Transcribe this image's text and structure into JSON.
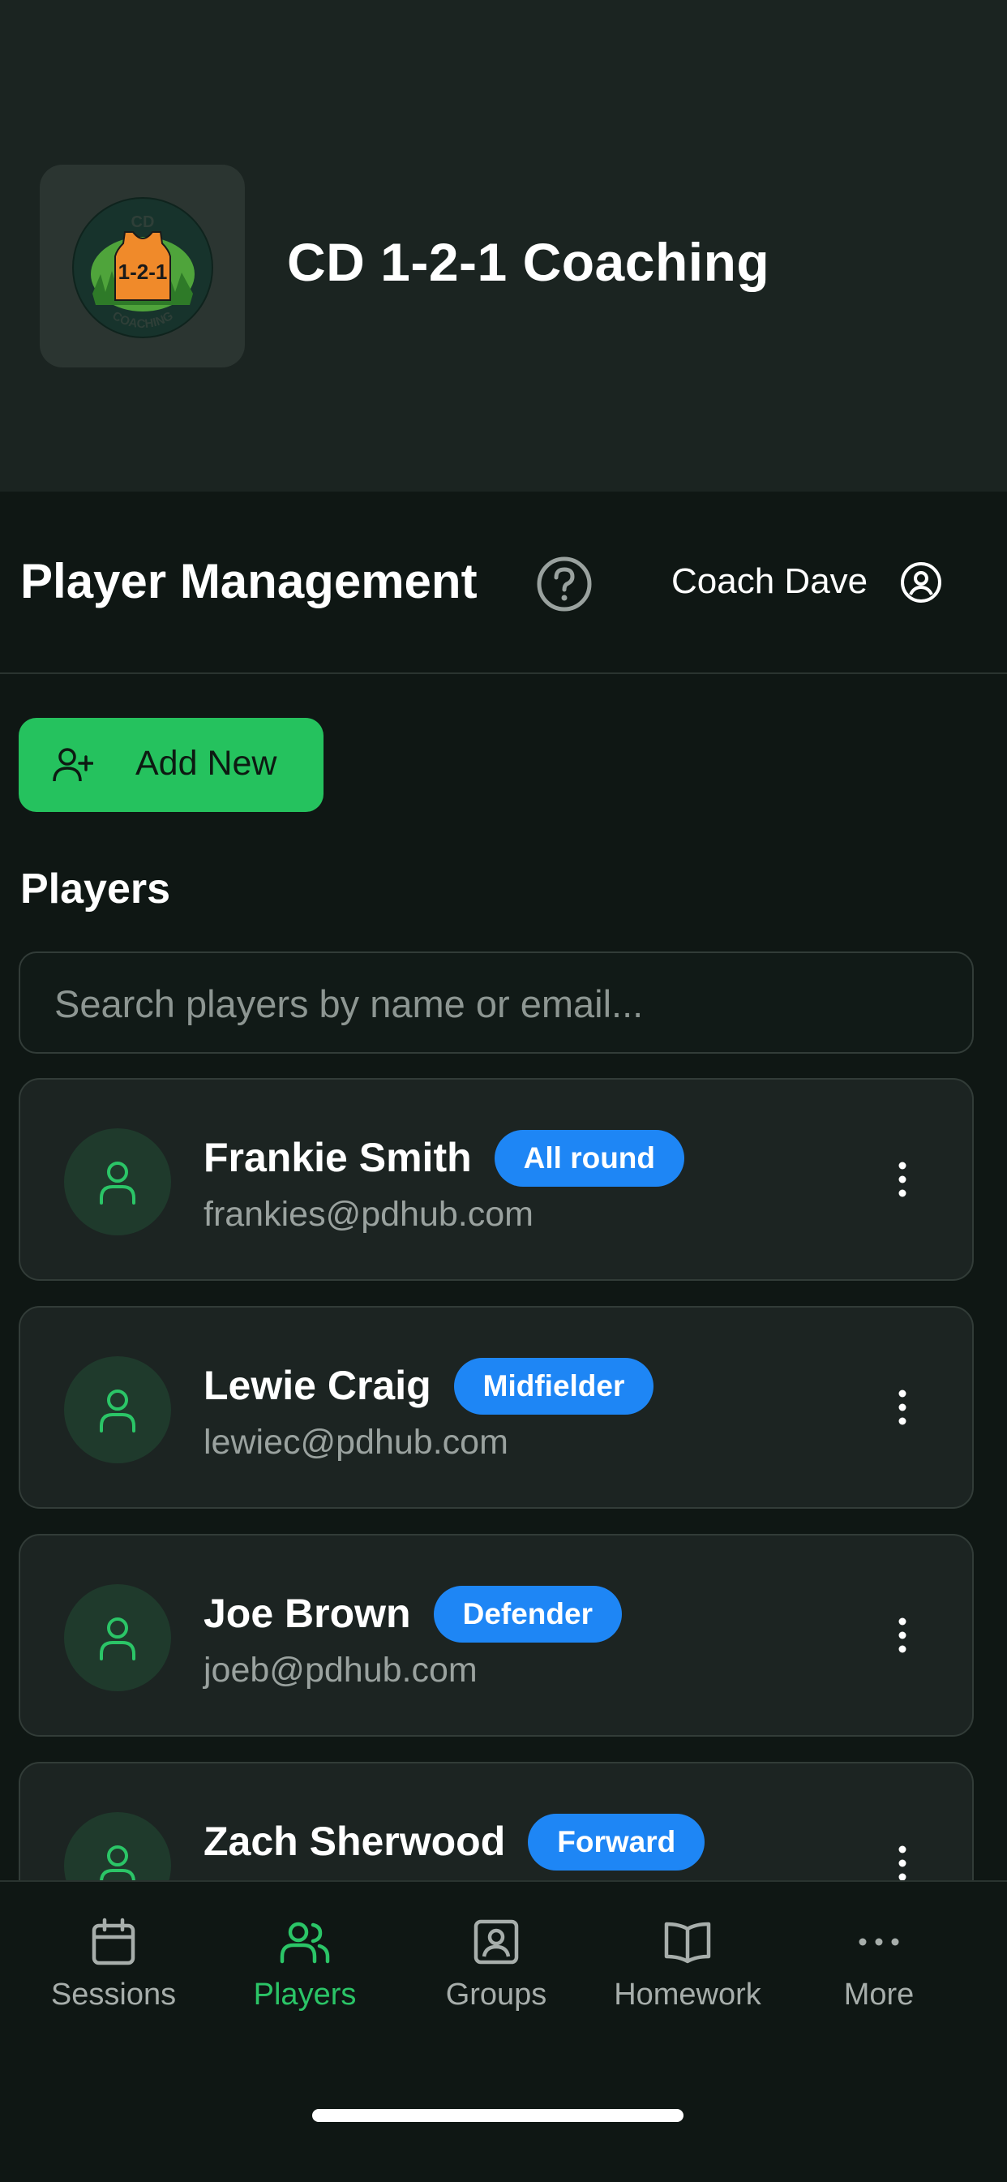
{
  "app": {
    "title": "CD 1-2-1 Coaching",
    "logo": {
      "top_text": "CD",
      "center_text": "1-2-1",
      "bottom_text": "COACHING"
    }
  },
  "page": {
    "title": "Player Management",
    "coach_name": "Coach Dave"
  },
  "toolbar": {
    "add_label": "Add New"
  },
  "players_section": {
    "title": "Players",
    "search_placeholder": "Search players by name or email..."
  },
  "players": [
    {
      "name": "Frankie Smith",
      "role": "All round",
      "email": "frankies@pdhub.com"
    },
    {
      "name": "Lewie Craig",
      "role": "Midfielder",
      "email": "lewiec@pdhub.com"
    },
    {
      "name": "Joe Brown",
      "role": "Defender",
      "email": "joeb@pdhub.com"
    },
    {
      "name": "Zach Sherwood",
      "role": "Forward",
      "email": ""
    }
  ],
  "nav": {
    "items": [
      {
        "label": "Sessions",
        "icon": "calendar-icon",
        "active": false
      },
      {
        "label": "Players",
        "icon": "users-icon",
        "active": true
      },
      {
        "label": "Groups",
        "icon": "user-square-icon",
        "active": false
      },
      {
        "label": "Homework",
        "icon": "book-icon",
        "active": false
      },
      {
        "label": "More",
        "icon": "more-icon",
        "active": false
      }
    ]
  },
  "colors": {
    "accent": "#25c25e",
    "badge": "#1e86f5",
    "background": "#0f1714",
    "card": "#1c2422"
  }
}
